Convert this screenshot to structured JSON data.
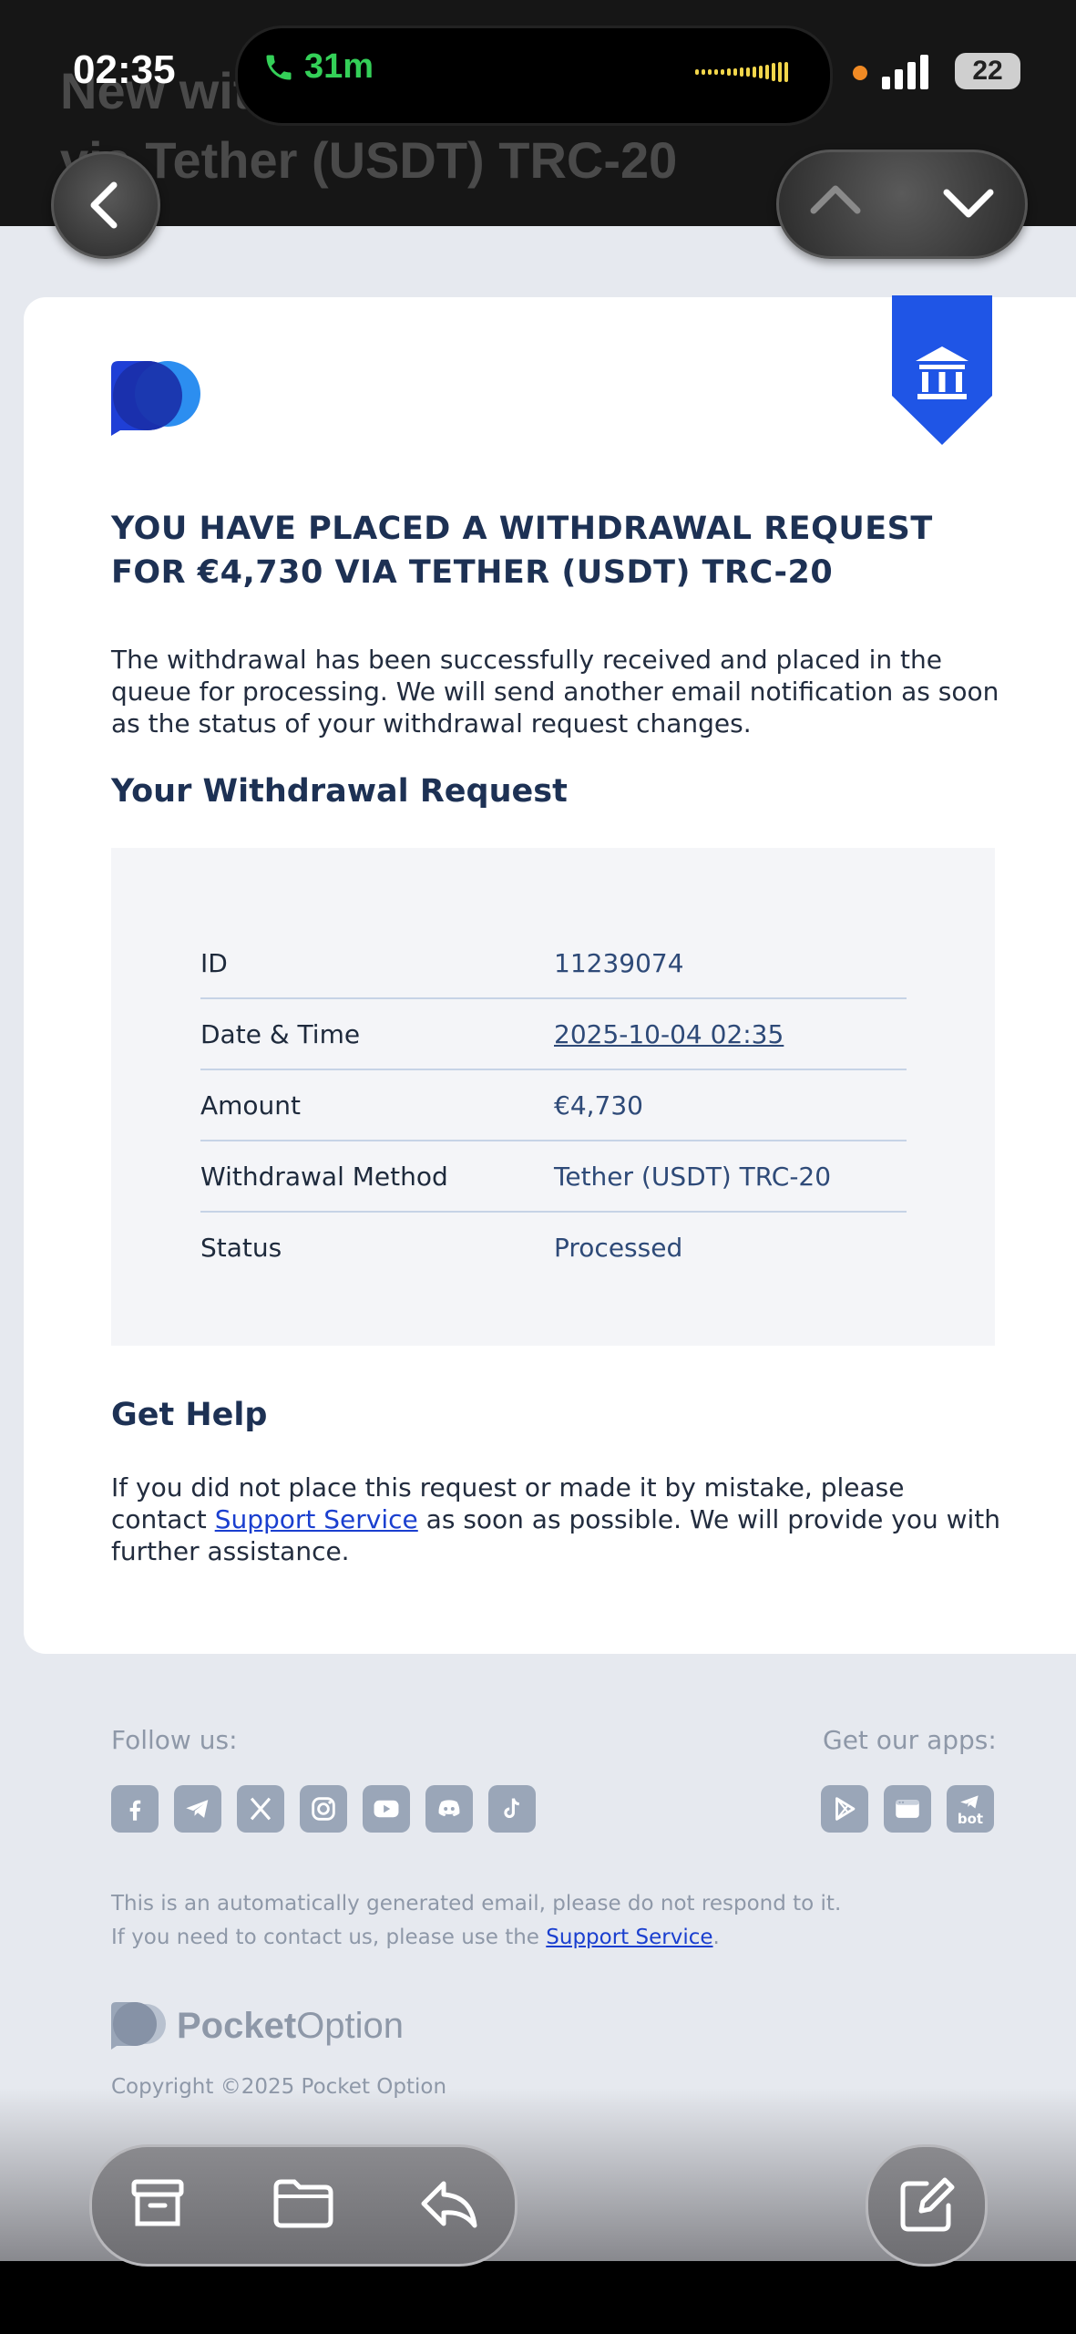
{
  "status_bar": {
    "time": "02:35",
    "call_duration": "31m",
    "battery": "22"
  },
  "header": {
    "subject_line1": "New withdrawal of €4,730",
    "subject_line2": "via Tether (USDT) TRC-20"
  },
  "email": {
    "title": "YOU HAVE PLACED A WITHDRAWAL REQUEST FOR €4,730 VIA TETHER (USDT) TRC-20",
    "intro": "The withdrawal has been successfully received and placed in the queue for processing. We will send another email notification as soon as the status of your withdrawal request changes.",
    "request_heading": "Your Withdrawal Request",
    "details": [
      {
        "label": "ID",
        "value": "11239074"
      },
      {
        "label": "Date & Time",
        "value": "2025-10-04 02:35"
      },
      {
        "label": "Amount",
        "value": "€4,730"
      },
      {
        "label": "Withdrawal Method",
        "value": "Tether (USDT) TRC-20"
      },
      {
        "label": "Status",
        "value": "Processed"
      }
    ],
    "help_heading": "Get Help",
    "help_text_before": "If you did not place this request or made it by mistake, please contact ",
    "help_link": "Support Service",
    "help_text_after": " as soon as possible. We will provide you with further assistance."
  },
  "footer": {
    "follow_label": "Follow us:",
    "apps_label": "Get our apps:",
    "auto_line1": "This is an automatically generated email, please do not respond to it.",
    "auto_line2_before": "If you need to contact us, please use the ",
    "auto_link": "Support Service",
    "auto_line2_after": ".",
    "brand_bold": "Pocket",
    "brand_light": "Option",
    "copyright": "Copyright ©2025 Pocket Option",
    "social_icons": [
      "facebook-icon",
      "telegram-icon",
      "x-icon",
      "instagram-icon",
      "youtube-icon",
      "discord-icon",
      "tiktok-icon"
    ],
    "app_icons": [
      "google-play-icon",
      "web-app-icon",
      "telegram-bot-icon"
    ],
    "bot_label": "bot"
  },
  "colors": {
    "title": "#1d3154",
    "link": "#1a3fcf",
    "ribbon": "#1f55e6",
    "footer_text": "#8e98a8"
  }
}
